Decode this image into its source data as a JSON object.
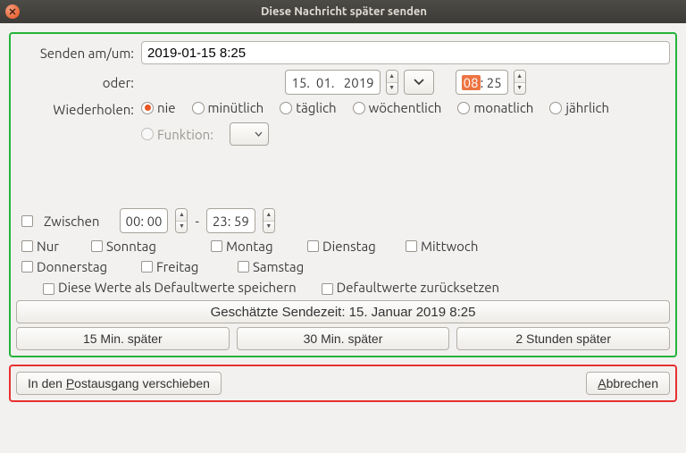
{
  "title": "Diese Nachricht später senden",
  "labels": {
    "send_at": "Senden am/um:",
    "or": "oder:",
    "repeat": "Wiederholen:",
    "function_label": "Funktion:",
    "between": "Zwischen",
    "only": "Nur",
    "dash": "-",
    "colon": ":"
  },
  "datetime_input": "2019-01-15 8:25",
  "date_parts": {
    "d": "15.",
    "m": "01.",
    "y": "2019"
  },
  "time_parts": {
    "h": "08",
    "min": "25"
  },
  "repeat_options": [
    "nie",
    "minütlich",
    "täglich",
    "wöchentlich",
    "monatlich",
    "jährlich"
  ],
  "between_from": {
    "h": "00",
    "m": "00"
  },
  "between_to": {
    "h": "23",
    "m": "59"
  },
  "days": [
    "Sonntag",
    "Montag",
    "Dienstag",
    "Mittwoch",
    "Donnerstag",
    "Freitag",
    "Samstag"
  ],
  "save_defaults": "Diese Werte als Defaultwerte speichern",
  "reset_defaults": "Defaultwerte zurücksetzen",
  "estimated": "Geschätzte Sendezeit: 15. Januar 2019 8:25",
  "later_buttons": [
    "15 Min. später",
    "30 Min. später",
    "2 Stunden später"
  ],
  "outbox_prefix": "In den ",
  "outbox_mnemonic": "P",
  "outbox_suffix": "ostausgang verschieben",
  "cancel_mnemonic": "A",
  "cancel_suffix": "bbrechen"
}
